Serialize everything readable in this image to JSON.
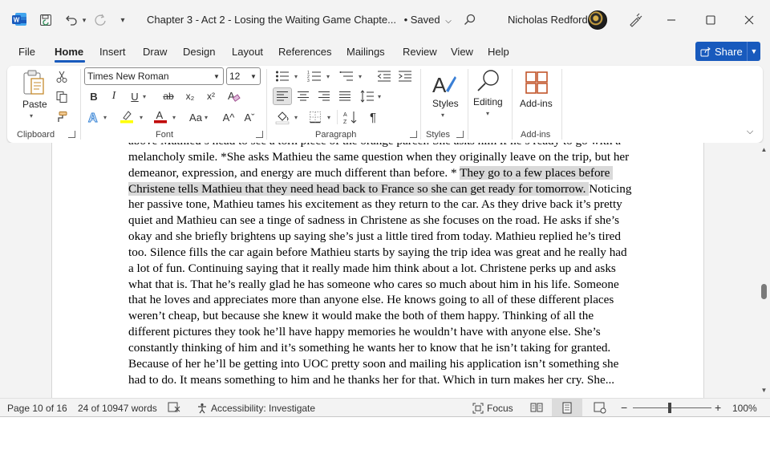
{
  "titlebar": {
    "doc_title": "Chapter 3 - Act 2 - Losing the Waiting Game Chapte...",
    "saved_status": "• Saved",
    "user_name": "Nicholas Redford",
    "icons": [
      "word-logo-icon",
      "save-icon",
      "undo-icon",
      "redo-icon",
      "customize-qat-icon",
      "search-icon",
      "designer-icon",
      "minimize-icon",
      "maximize-icon",
      "close-icon"
    ]
  },
  "menu": {
    "tabs": [
      {
        "label": "File"
      },
      {
        "label": "Home"
      },
      {
        "label": "Insert"
      },
      {
        "label": "Draw"
      },
      {
        "label": "Design"
      },
      {
        "label": "Layout"
      },
      {
        "label": "References"
      },
      {
        "label": "Mailings"
      },
      {
        "label": "Review"
      },
      {
        "label": "View"
      },
      {
        "label": "Help"
      }
    ],
    "active_tab": "Home",
    "share_label": "Share"
  },
  "ribbon": {
    "clipboard": {
      "paste_label": "Paste",
      "group_label": "Clipboard"
    },
    "font": {
      "font_name": "Times New Roman",
      "font_size": "12",
      "group_label": "Font",
      "bold": "B",
      "italic": "I",
      "underline": "U",
      "strike": "ab",
      "subscript": "x₂",
      "superscript": "x²",
      "change_case": "Aa",
      "grow": "A^",
      "shrink": "Aˇ",
      "highlight_color": "#ffff00",
      "font_color": "#c00000"
    },
    "paragraph": {
      "group_label": "Paragraph"
    },
    "styles": {
      "label": "Styles",
      "group_label": "Styles"
    },
    "editing": {
      "label": "Editing"
    },
    "addins": {
      "label": "Add-ins",
      "group_label": "Add-ins"
    }
  },
  "document": {
    "before_highlight": "above Mathieu’s head to see a torn piece of the orange parcel. She asks him if he’s ready to go with a melancholy smile. *She asks Mathieu the same question when they originally leave on the trip, but her demeanor, expression, and energy are much different than before. * ",
    "highlighted": "They go to a few places before Christene tells Mathieu that they need head back to France so she can get ready for tomorrow. ",
    "after_highlight": "Noticing her passive tone, Mathieu tames his excitement as they return to the car. As they drive back it’s pretty quiet and Mathieu can see a tinge of sadness in Christene as she focuses on the road. He asks if she’s okay and she briefly brightens up saying she’s just a little tired from today. Mathieu replied he’s tired too. Silence fills the car again before Mathieu starts by saying the trip idea was great and he really had a lot of fun. Continuing saying that it really made him think about a lot. Christene perks up and asks what that is. That he’s really glad he has someone who cares so much about him in his life. Someone that he loves and appreciates more than anyone else. He knows going to all of these different places weren’t cheap, but because she knew it would make the both of them happy. Thinking of all the different pictures they took he’ll have happy memories he wouldn’t have with anyone else. She’s constantly thinking of him and it’s something he wants her to know that he isn’t taking for granted. Because of her he’ll be getting into UOC pretty soon and mailing his application isn’t something she had to do. It means something to him and he thanks her for that. Which in turn makes her cry. She..."
  },
  "statusbar": {
    "page": "Page 10 of 16",
    "words": "24 of 10947 words",
    "accessibility": "Accessibility: Investigate",
    "focus": "Focus",
    "zoom_minus": "−",
    "zoom_plus": "+",
    "zoom": "100%",
    "zoom_fraction": 0.47
  },
  "colors": {
    "accent": "#185abd",
    "chrome_bg": "#f3f3f3",
    "selection": "#d9d9d9"
  }
}
